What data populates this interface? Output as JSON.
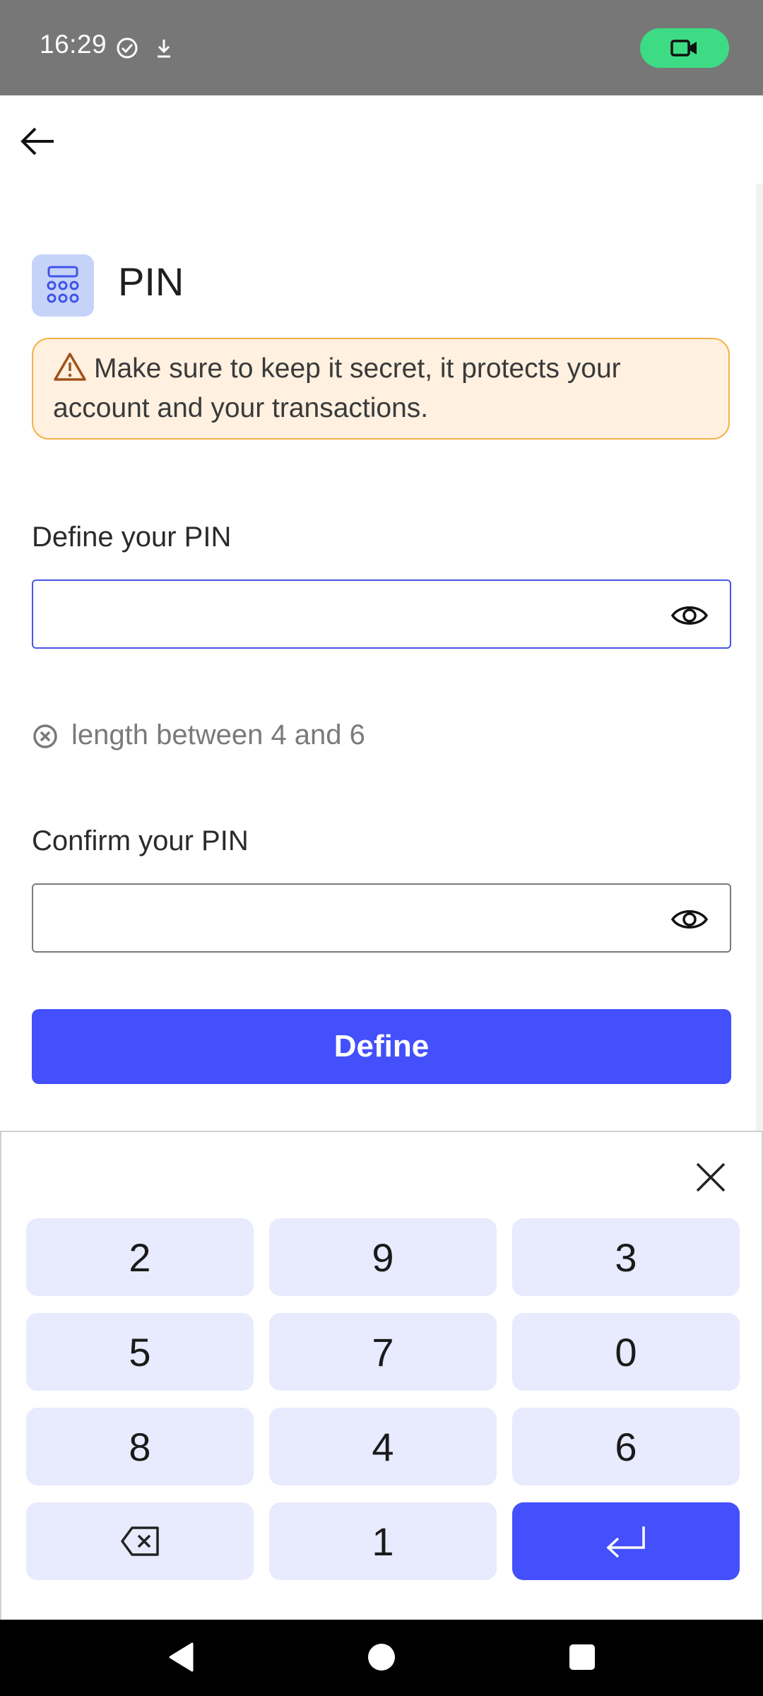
{
  "status_bar": {
    "time": "16:29",
    "icons": [
      "check-circle-icon",
      "download-icon"
    ],
    "recording_color": "#3ddc84"
  },
  "header": {
    "back_icon": "arrow-left-icon"
  },
  "section": {
    "title": "PIN",
    "icon": "keypad-icon"
  },
  "warning": {
    "text": "Make sure to keep it secret, it protects your account and your transactions.",
    "icon": "warning-triangle-icon",
    "background": "#fff0e0",
    "border": "#f4b247"
  },
  "define_field": {
    "label": "Define your PIN",
    "value": "",
    "state": "focused"
  },
  "rule": {
    "text": "length between 4 and 6",
    "status": "unmet"
  },
  "confirm_field": {
    "label": "Confirm your PIN",
    "value": ""
  },
  "define_button": {
    "label": "Define",
    "color": "#4450fb"
  },
  "keypad": {
    "rows": [
      [
        "2",
        "9",
        "3"
      ],
      [
        "5",
        "7",
        "0"
      ],
      [
        "8",
        "4",
        "6"
      ]
    ],
    "last_row": [
      "backspace",
      "1",
      "enter"
    ],
    "key_color": "#e8eafd"
  }
}
